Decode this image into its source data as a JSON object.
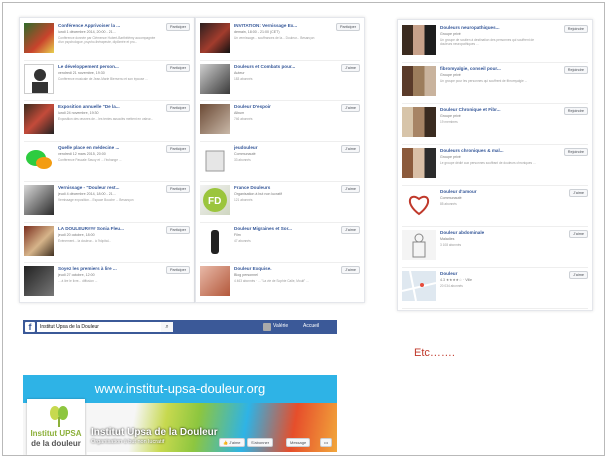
{
  "events": [
    {
      "title": "Conférence Apprivoiser la ...",
      "date": "lundi 1 décembre 2014, 20:00 - 21...",
      "desc": "Conférence donnée par Clémence Hubert-Barthélémy accompagnée d'un psychologue, psycho-thérapeute, diplômée et pro...",
      "place": "Amicale de Neuilly ...",
      "button": "Participer"
    },
    {
      "title": "Le développement person...",
      "date": "vendredi 21 novembre, 19:30",
      "desc": "Conférence musicale de Jean-Marie Bienvenu et son épouse ...",
      "place": "12 rue Anatole, Besançon",
      "button": "Participer"
    },
    {
      "title": "Exposition annuelle \"De la...",
      "date": "lundi 24 novembre, 19:30",
      "desc": "Exposition des œuvres de... les textes associés mettent en valeur...",
      "place": "110... Besançon",
      "button": "Participer"
    },
    {
      "title": "Quelle place en médecine ...",
      "date": "vendredi 12 mars 2015, 20:00",
      "desc": "Conférence Pascale Savoy et ... l'échange ...",
      "place": "Salle du... Besançon",
      "button": "Participer"
    },
    {
      "title": "Vernissage - \"Douleur rest...",
      "date": "jeudi 4 décembre 2014, 18:00 - 21...",
      "desc": "Vernissage exposition... Espace Bouche ... Besançon",
      "place": "Espace Bouche ...",
      "button": "Participer"
    },
    {
      "title": "LA DOULEUR### Sonia Fleu...",
      "date": "jeudi 20 octobre, 18:00",
      "desc": "Événement... la douleur... à l'hôpital...",
      "place": "... Besançon",
      "button": "Participer"
    },
    {
      "title": "Soyez les premiers à lire ...",
      "date": "jeudi 27 octobre, 12:00",
      "desc": "... à lire le livre... diffusion ...",
      "place": "",
      "button": "Participer"
    }
  ],
  "pages_left": [
    {
      "title": "INVITATION: Vernissage Ex...",
      "sub": "demain, 18:00 - 21:00 (CET)",
      "desc": "Un vernissage... souffrances de la... Douleur... Besançon",
      "button": "Participer"
    },
    {
      "title": "Douleurs et Combats pour...",
      "sub": "Auteur",
      "desc": "183 abonnés",
      "button": "J'aime"
    },
    {
      "title": "Douleur D'espoir",
      "sub": "Album",
      "desc": "746 abonnés",
      "button": "J'aime"
    },
    {
      "title": "jeudouleur",
      "sub": "Communauté",
      "desc": "33 abonnés",
      "button": "J'aime"
    },
    {
      "title": "France Douleurs",
      "sub": "Organisation à but non lucratif",
      "desc": "121 abonnés",
      "button": "J'aime"
    },
    {
      "title": "Douleur Migraines et Sor...",
      "sub": "Film",
      "desc": "47 abonnés",
      "button": "J'aime"
    },
    {
      "title": "Douleur Exquise.",
      "sub": "Blog personnel",
      "desc": "4 463 abonnés · ... \"La vie de Sophie Calle, Moult\" ...",
      "button": "J'aime"
    }
  ],
  "pages_right": [
    {
      "title": "Douleurs neuropathiques...",
      "sub": "Groupe privé",
      "desc": "Un groupe de soutien à destination des personnes qui souffrent de douleurs neuropathiques ...",
      "extra": "423 membres",
      "button": "Rejoindre"
    },
    {
      "title": "fibromyalgie, conseil pour...",
      "sub": "Groupe privé",
      "desc": "Un groupe pour les personnes qui souffrent de fibromyalgie ...",
      "extra": "2 901 membres",
      "button": "Rejoindre"
    },
    {
      "title": "Douleur Chronique et Fibr...",
      "sub": "Groupe privé",
      "desc": "19 membres",
      "extra": "",
      "button": "Rejoindre"
    },
    {
      "title": "Douleurs chroniques & mal...",
      "sub": "Groupe privé",
      "desc": "Le groupe dédié aux personnes souffrant de douleurs chroniques ...",
      "extra": "121 membres",
      "button": "Rejoindre"
    },
    {
      "title": "Douleur d'amour",
      "sub": "Communauté",
      "desc": "85 abonnés",
      "extra": "",
      "button": "J'aime"
    },
    {
      "title": "Douleur abdominale",
      "sub": "Maladies",
      "desc": "3 108 abonnés",
      "extra": "",
      "button": "J'aime"
    },
    {
      "title": "Douleur",
      "sub": "4.3 ★★★★☆ · Ville",
      "desc": "20 034 abonnés",
      "extra": "",
      "button": "J'aime"
    }
  ],
  "fb_bar": {
    "search_value": "Institut Upsa de la Douleur",
    "user": "Valérie",
    "home": "Accueil"
  },
  "etc": "Etc…….",
  "cover": {
    "url": "www.institut-upsa-douleur.org",
    "logo_line1": "Institut UPSA",
    "logo_line2": "de la douleur",
    "page_name": "Institut Upsa de la Douleur",
    "category": "Organisation à but non lucratif",
    "like": "J'aime",
    "follow": "S'abonner",
    "message": "Message",
    "more": "•••"
  },
  "colors": {
    "fb_blue": "#3b5998",
    "link": "#365899",
    "banner": "#2eb3e6",
    "etc": "#c0392b",
    "logo_green": "#8cb03a"
  }
}
